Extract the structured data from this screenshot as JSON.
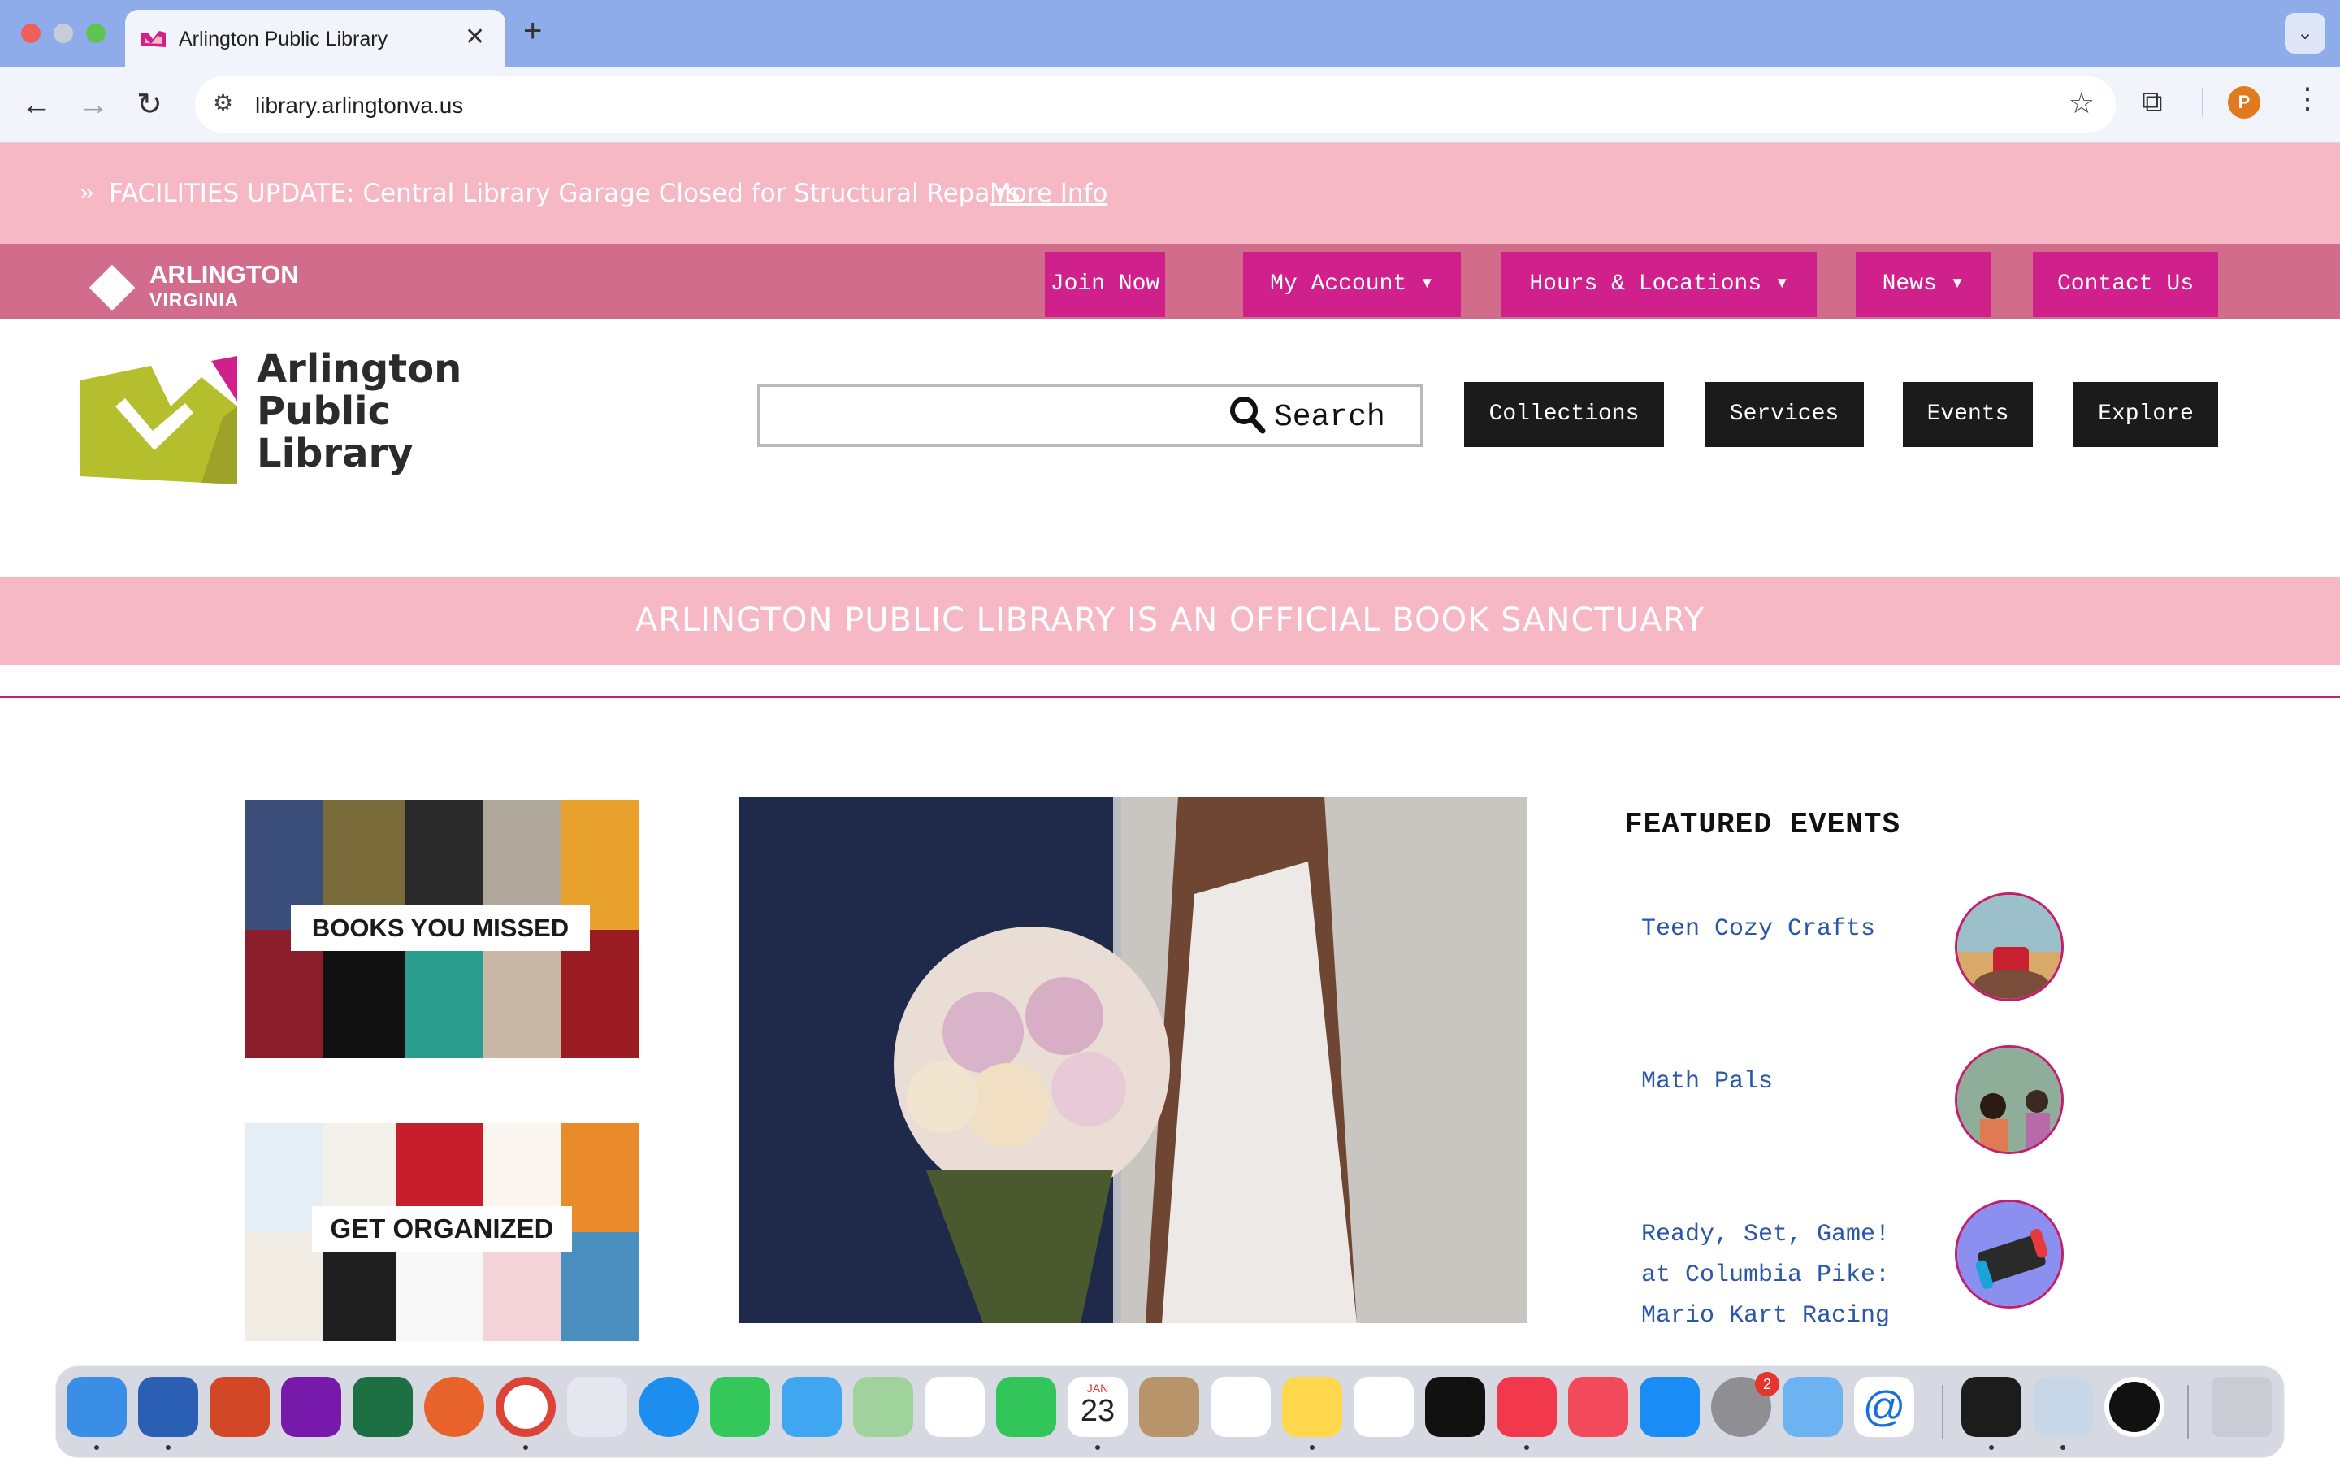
{
  "browser": {
    "tab_title": "Arlington Public Library",
    "tab_close": "✕",
    "new_tab": "+",
    "url": "library.arlingtonva.us",
    "profile_initial": "P"
  },
  "alert": {
    "prefix": "»",
    "text": "FACILITIES UPDATE: Central Library Garage Closed for Structural Repairs",
    "link": "More Info"
  },
  "county": {
    "name_line1": "ARLINGTON",
    "name_line2": "VIRGINIA"
  },
  "topnav": {
    "items": [
      {
        "label": "Join Now"
      },
      {
        "label": "My Account ▾"
      },
      {
        "label": "Hours & Locations ▾"
      },
      {
        "label": "News ▾"
      },
      {
        "label": "Contact Us"
      }
    ]
  },
  "logo": {
    "line1": "Arlington",
    "line2": "Public",
    "line3": "Library"
  },
  "search": {
    "label": "Search"
  },
  "mainnav": {
    "items": [
      {
        "label": "Collections"
      },
      {
        "label": "Services"
      },
      {
        "label": "Events"
      },
      {
        "label": "Explore"
      }
    ]
  },
  "sanctuary": {
    "text": "ARLINGTON PUBLIC LIBRARY IS AN OFFICIAL BOOK SANCTUARY"
  },
  "promos": [
    {
      "label": "BOOKS YOU  MISSED"
    },
    {
      "label": "GET ORGANIZED"
    }
  ],
  "featured_events": {
    "title": "FEATURED EVENTS",
    "events": [
      {
        "title": "Teen Cozy Crafts"
      },
      {
        "title": "Math Pals"
      },
      {
        "title_lines": [
          "Ready, Set, Game!",
          "at Columbia Pike:",
          "Mario Kart Racing"
        ]
      }
    ]
  },
  "dock": {
    "calendar_month": "JAN",
    "calendar_day": "23",
    "settings_badge": "2",
    "apps": [
      "Finder",
      "Word",
      "PowerPoint",
      "OneNote",
      "Excel",
      "Firefox",
      "Chrome",
      "Launchpad",
      "Safari",
      "Messages",
      "Mail",
      "Maps",
      "Photos",
      "FaceTime",
      "Calendar",
      "Contacts",
      "Reminders",
      "Notes",
      "Freeform",
      "TV",
      "Music",
      "News",
      "App Store",
      "System Settings",
      "Folder",
      "Mail Alias",
      "Terminal",
      "Preview",
      "Clock",
      "Trash"
    ]
  }
}
